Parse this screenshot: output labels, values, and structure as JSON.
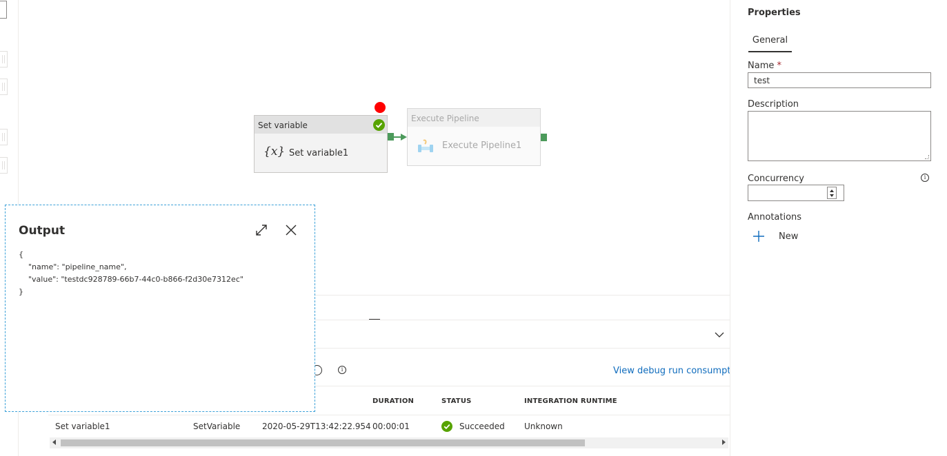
{
  "canvas": {
    "activity1": {
      "header": "Set variable",
      "name": "Set variable1",
      "icon": "x-variable-icon"
    },
    "activity2": {
      "header": "Execute Pipeline",
      "name": "Execute Pipeline1",
      "icon": "pipeline-icon"
    }
  },
  "output": {
    "title": "Output",
    "json_text": "{\n    \"name\": \"pipeline_name\",\n    \"value\": \"testdc928789-66b7-44c0-b866-f2d30e7312ec\"\n}"
  },
  "run_panel": {
    "debug_link": "View debug run consumption",
    "columns": {
      "duration": "DURATION",
      "status": "STATUS",
      "integration_runtime": "INTEGRATION RUNTIME"
    },
    "rows": [
      {
        "activity_name": "Set variable1",
        "activity_type": "SetVariable",
        "run_start": "2020-05-29T13:42:22.954",
        "duration": "00:00:01",
        "status": "Succeeded",
        "integration_runtime": "Unknown"
      }
    ]
  },
  "properties": {
    "title": "Properties",
    "tab_general": "General",
    "name_label": "Name",
    "required_mark": "*",
    "name_value": "test",
    "description_label": "Description",
    "concurrency_label": "Concurrency",
    "annotations_label": "Annotations",
    "new_label": "New"
  },
  "colors": {
    "success": "#57a300",
    "connector": "#4c9a5b",
    "breakpoint": "#ff0000",
    "link": "#0f6cbd"
  }
}
